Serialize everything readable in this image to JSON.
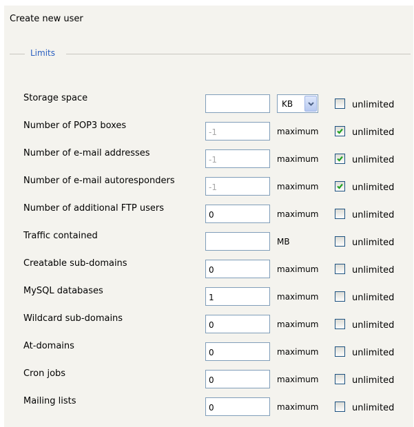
{
  "page_title": "Create new user",
  "legend": "Limits",
  "unlimited_label": "unlimited",
  "icons": {
    "checkbox_checked": "check-icon",
    "select_arrow": "chevron-down-icon"
  },
  "colors": {
    "legend": "#2a5fc0",
    "check": "#21a121",
    "panel_bg": "#f4f3ee",
    "input_border": "#7f9db9"
  },
  "limits": [
    {
      "label": "Storage space",
      "value": "",
      "disabled": false,
      "unit_select": "KB",
      "unit": "",
      "unlimited": false
    },
    {
      "label": "Number of POP3 boxes",
      "value": "-1",
      "disabled": true,
      "unit": "maximum",
      "unlimited": true
    },
    {
      "label": "Number of e-mail addresses",
      "value": "-1",
      "disabled": true,
      "unit": "maximum",
      "unlimited": true
    },
    {
      "label": "Number of e-mail autoresponders",
      "value": "-1",
      "disabled": true,
      "unit": "maximum",
      "unlimited": true
    },
    {
      "label": "Number of additional FTP users",
      "value": "0",
      "disabled": false,
      "unit": "maximum",
      "unlimited": false
    },
    {
      "label": "Traffic contained",
      "value": "",
      "disabled": false,
      "unit": "MB",
      "unlimited": false
    },
    {
      "label": "Creatable sub-domains",
      "value": "0",
      "disabled": false,
      "unit": "maximum",
      "unlimited": false
    },
    {
      "label": "MySQL databases",
      "value": "1",
      "disabled": false,
      "unit": "maximum",
      "unlimited": false
    },
    {
      "label": "Wildcard sub-domains",
      "value": "0",
      "disabled": false,
      "unit": "maximum",
      "unlimited": false
    },
    {
      "label": "At-domains",
      "value": "0",
      "disabled": false,
      "unit": "maximum",
      "unlimited": false
    },
    {
      "label": "Cron jobs",
      "value": "0",
      "disabled": false,
      "unit": "maximum",
      "unlimited": false
    },
    {
      "label": "Mailing lists",
      "value": "0",
      "disabled": false,
      "unit": "maximum",
      "unlimited": false
    }
  ]
}
